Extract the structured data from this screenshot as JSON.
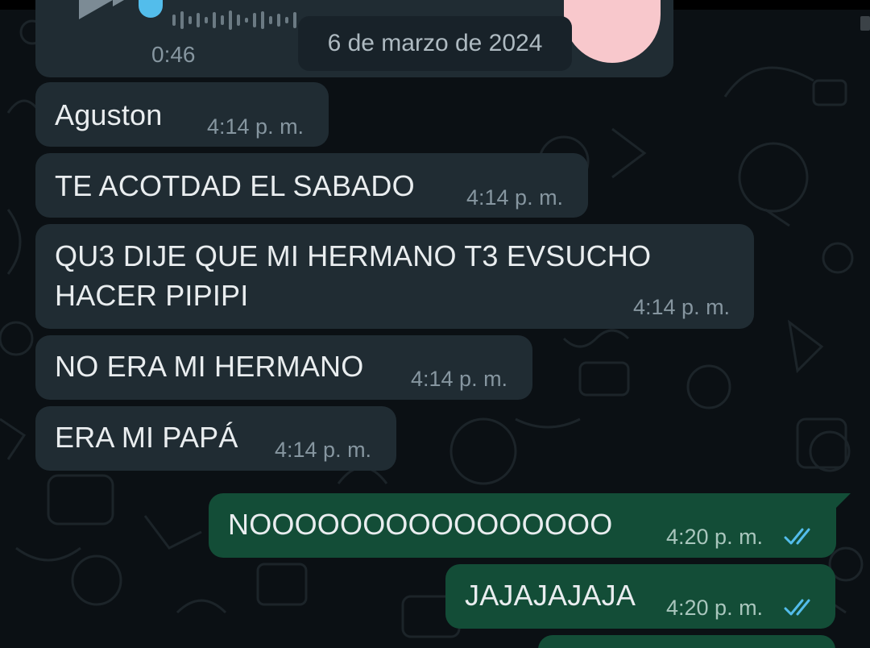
{
  "audio_message": {
    "duration": "0:46"
  },
  "date_separator": "6 de marzo de 2024",
  "messages": [
    {
      "direction": "in",
      "lines": [
        "Aguston"
      ],
      "time": "4:14 p. m."
    },
    {
      "direction": "in",
      "lines": [
        "TE ACOTDAD EL SABADO"
      ],
      "time": "4:14 p. m."
    },
    {
      "direction": "in",
      "lines": [
        "QU3 DIJE QUE MI HERMANO T3 EVSUCHO",
        "HACER PIPIPI"
      ],
      "time": "4:14 p. m."
    },
    {
      "direction": "in",
      "lines": [
        "NO ERA MI HERMANO"
      ],
      "time": "4:14 p. m."
    },
    {
      "direction": "in",
      "lines": [
        "ERA MI PAPÁ"
      ],
      "time": "4:14 p. m."
    },
    {
      "direction": "out",
      "lines": [
        "NOOOOOOOOOOOOOOOO"
      ],
      "time": "4:20 p. m.",
      "status_icon": "double-check-read-icon"
    },
    {
      "direction": "out",
      "lines": [
        "JAJAJAJAJA"
      ],
      "time": "4:20 p. m.",
      "status_icon": "double-check-read-icon"
    }
  ],
  "colors": {
    "background": "#0b1014",
    "incoming_bubble": "#202c33",
    "outgoing_bubble": "#134d37",
    "read_ticks": "#53bdeb"
  }
}
